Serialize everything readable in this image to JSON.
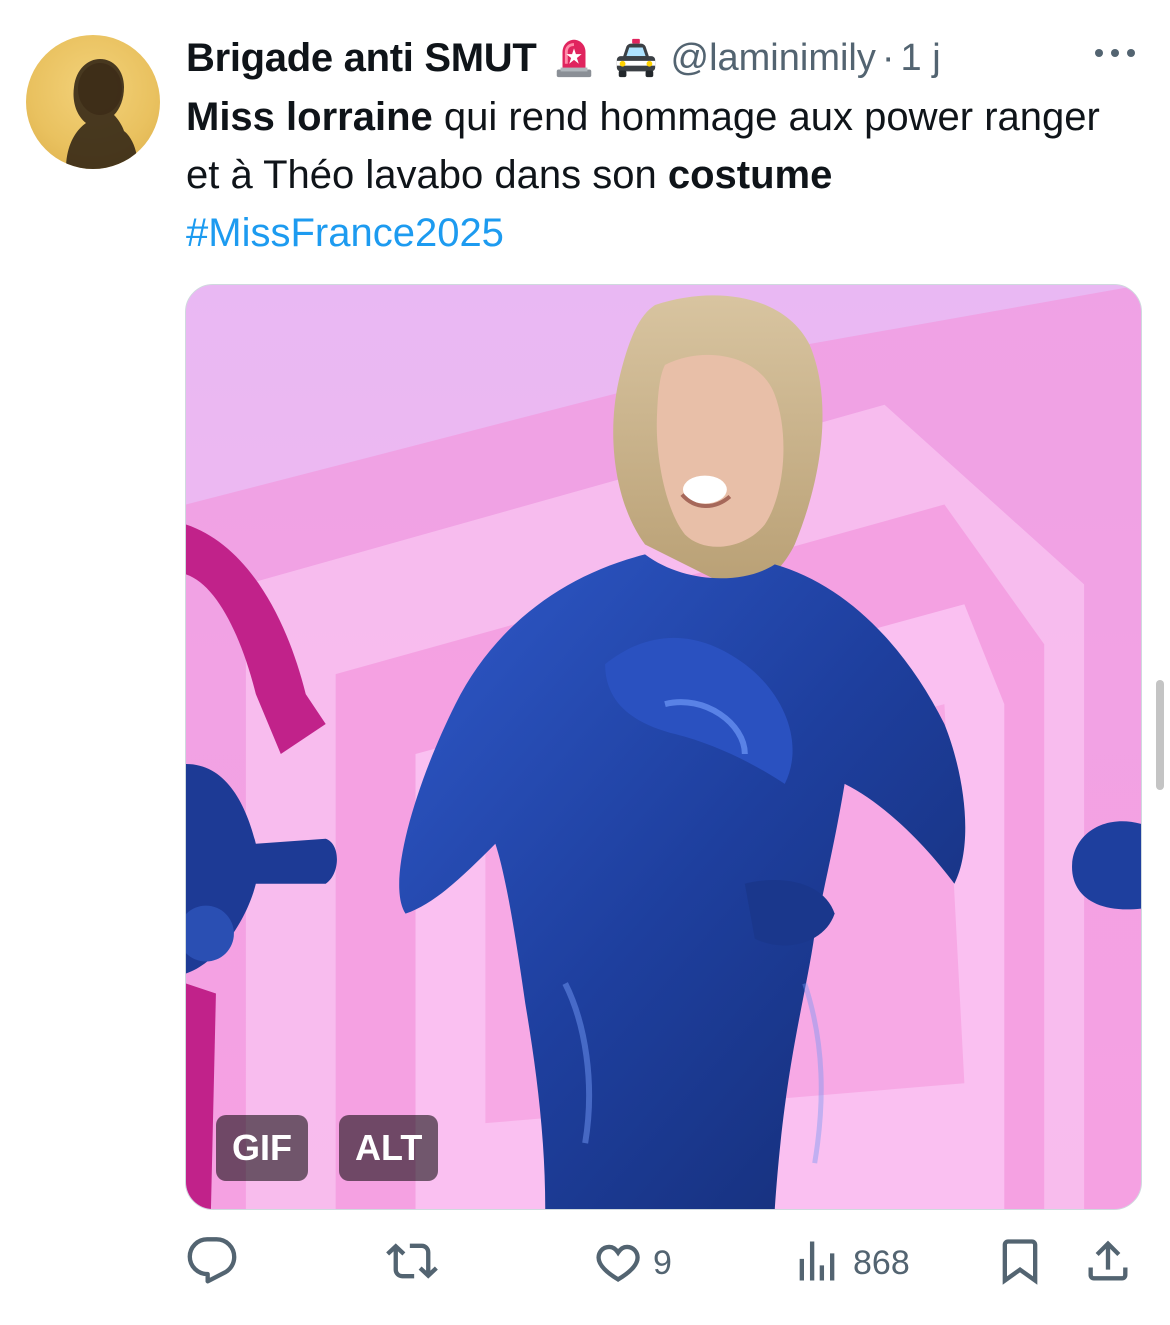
{
  "author": {
    "display_name": "Brigade anti SMUT",
    "emojis": [
      "police-light-icon",
      "police-car-icon"
    ],
    "handle": "@laminimily",
    "separator": "·",
    "time": "1 j"
  },
  "tweet": {
    "text_parts": [
      {
        "text": "Miss lorraine",
        "bold": true
      },
      {
        "text": " qui rend hommage aux power ranger et à Théo lavabo dans son ",
        "bold": false
      },
      {
        "text": "costume",
        "bold": true
      }
    ],
    "hashtag": "#MissFrance2025"
  },
  "media": {
    "badges": {
      "gif": "GIF",
      "alt": "ALT"
    }
  },
  "actions": {
    "reply_count": "",
    "retweet_count": "",
    "like_count": "9",
    "views_count": "868"
  },
  "colors": {
    "link": "#1d9bf0",
    "secondary_text": "#536471",
    "primary_text": "#0f1419"
  }
}
